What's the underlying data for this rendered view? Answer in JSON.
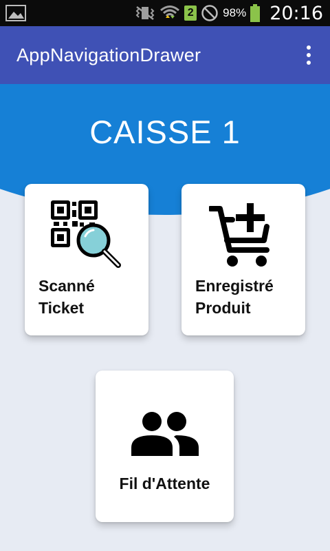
{
  "status_bar": {
    "sim_number": "2",
    "battery_percent": "98%",
    "time": "20:16"
  },
  "app_bar": {
    "title": "AppNavigationDrawer"
  },
  "header": {
    "title": "CAISSE 1"
  },
  "cards": {
    "scan": {
      "line1": "Scanné",
      "line2": "Ticket",
      "icon": "qr-scan-icon"
    },
    "product": {
      "line1": "Enregistré",
      "line2": "Produit",
      "icon": "cart-add-icon"
    },
    "queue": {
      "line1": "Fil d'Attente",
      "icon": "people-icon"
    }
  },
  "colors": {
    "app_bar": "#3f51b5",
    "hero": "#1680d6",
    "background": "#e7ebf3",
    "magnifier_glass": "#86d0d8"
  }
}
